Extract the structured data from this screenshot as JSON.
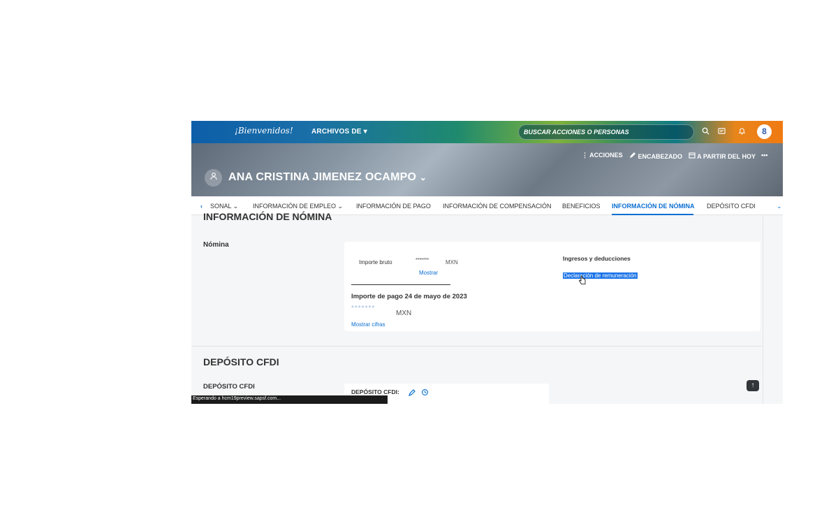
{
  "topbar": {
    "welcome": "¡Bienvenidos!",
    "archivos": "ARCHIVOS DE ▾",
    "search_placeholder": "BUSCAR ACCIONES O PERSONAS",
    "avatar_initial": "8"
  },
  "header": {
    "acciones": "ACCIONES",
    "encabezado": "ENCABEZADO",
    "a_partir": "A PARTIR DEL HOY",
    "more": "•••",
    "person_name": "ANA CRISTINA JIMENEZ OCAMPO",
    "person_chevron": "⌄"
  },
  "tabs": [
    {
      "label": "‹"
    },
    {
      "label": "SONAL ⌄"
    },
    {
      "label": "INFORMACIÓN DE EMPLEO ⌄"
    },
    {
      "label": "INFORMACIÓN DE PAGO"
    },
    {
      "label": "INFORMACIÓN DE COMPENSACIÓN"
    },
    {
      "label": "BENEFICIOS"
    },
    {
      "label": "INFORMACIÓN DE NÓMINA"
    },
    {
      "label": "DEPÓSITO CFDI"
    },
    {
      "label": "⌄"
    }
  ],
  "nomina_section": {
    "title": "INFORMACIÓN DE NÓMINA",
    "sub_label": "Nómina",
    "importe_bruto_label": "Importe bruto",
    "importe_bruto_masked": "*******",
    "importe_bruto_currency": "MXN",
    "mostrar": "Mostrar",
    "importe_pago_label": "Importe de pago 24 de mayo de 2023",
    "importe_pago_masked": "*******",
    "importe_pago_currency": "MXN",
    "mostrar_cifras": "Mostrar cifras",
    "ingresos_label": "Ingresos y deducciones",
    "declaracion_link": "Declaración de remuneración"
  },
  "cfdi_section": {
    "title": "DEPÓSITO CFDI",
    "sub_label": "DEPÓSITO CFDI",
    "card_label": "DEPÓSITO CFDI:"
  },
  "statusbar": {
    "text": "Esperando a hcm19preview.sapsf.com..."
  },
  "colors": {
    "accent": "#0a6ed1",
    "topbar_orange": "#f07a12",
    "topbar_blue": "#0d5ea8"
  }
}
